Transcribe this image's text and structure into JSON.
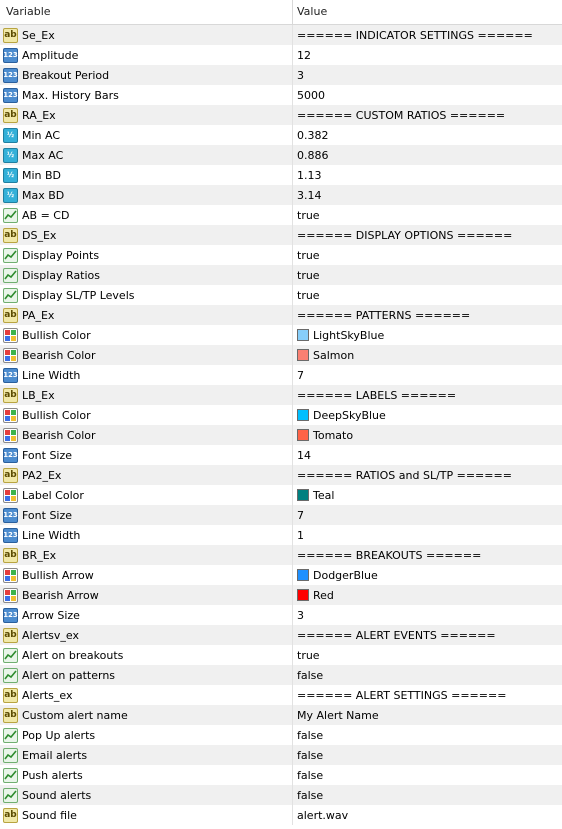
{
  "header": {
    "variable": "Variable",
    "value": "Value"
  },
  "rows": [
    {
      "icon": "ab",
      "name": "Se_Ex",
      "value": "====== INDICATOR SETTINGS ======"
    },
    {
      "icon": "123",
      "name": "Amplitude",
      "value": "12"
    },
    {
      "icon": "123",
      "name": "Breakout Period",
      "value": "3"
    },
    {
      "icon": "123",
      "name": "Max. History Bars",
      "value": "5000"
    },
    {
      "icon": "ab",
      "name": "RA_Ex",
      "value": "====== CUSTOM RATIOS ======"
    },
    {
      "icon": "half",
      "name": "Min AC",
      "value": "0.382"
    },
    {
      "icon": "half",
      "name": "Max AC",
      "value": "0.886"
    },
    {
      "icon": "half",
      "name": "Min BD",
      "value": "1.13"
    },
    {
      "icon": "half",
      "name": "Max BD",
      "value": "3.14"
    },
    {
      "icon": "bool",
      "name": "AB = CD",
      "value": "true"
    },
    {
      "icon": "ab",
      "name": "DS_Ex",
      "value": "====== DISPLAY OPTIONS ======"
    },
    {
      "icon": "bool",
      "name": "Display Points",
      "value": "true"
    },
    {
      "icon": "bool",
      "name": "Display Ratios",
      "value": "true"
    },
    {
      "icon": "bool",
      "name": "Display SL/TP Levels",
      "value": "true"
    },
    {
      "icon": "ab",
      "name": "PA_Ex",
      "value": "====== PATTERNS  ======"
    },
    {
      "icon": "color",
      "name": "Bullish Color",
      "value": "LightSkyBlue",
      "swatch": "#87cefa"
    },
    {
      "icon": "color",
      "name": "Bearish Color",
      "value": "Salmon",
      "swatch": "#fa8072"
    },
    {
      "icon": "123",
      "name": "Line Width",
      "value": "7"
    },
    {
      "icon": "ab",
      "name": "LB_Ex",
      "value": "====== LABELS ======"
    },
    {
      "icon": "color",
      "name": "Bullish Color",
      "value": "DeepSkyBlue",
      "swatch": "#00bfff"
    },
    {
      "icon": "color",
      "name": "Bearish Color",
      "value": "Tomato",
      "swatch": "#ff6347"
    },
    {
      "icon": "123",
      "name": "Font Size",
      "value": "14"
    },
    {
      "icon": "ab",
      "name": "PA2_Ex",
      "value": "====== RATIOS and SL/TP ======"
    },
    {
      "icon": "color",
      "name": "Label Color",
      "value": "Teal",
      "swatch": "#008080"
    },
    {
      "icon": "123",
      "name": "Font Size",
      "value": "7"
    },
    {
      "icon": "123",
      "name": "Line Width",
      "value": "1"
    },
    {
      "icon": "ab",
      "name": "BR_Ex",
      "value": "====== BREAKOUTS ======"
    },
    {
      "icon": "color",
      "name": "Bullish Arrow",
      "value": "DodgerBlue",
      "swatch": "#1e90ff"
    },
    {
      "icon": "color",
      "name": "Bearish Arrow",
      "value": "Red",
      "swatch": "#ff0000"
    },
    {
      "icon": "123",
      "name": "Arrow Size",
      "value": "3"
    },
    {
      "icon": "ab",
      "name": "Alertsv_ex",
      "value": "====== ALERT EVENTS ======"
    },
    {
      "icon": "bool",
      "name": "Alert on breakouts",
      "value": "true"
    },
    {
      "icon": "bool",
      "name": "Alert on patterns",
      "value": "false"
    },
    {
      "icon": "ab",
      "name": "Alerts_ex",
      "value": "====== ALERT SETTINGS ======"
    },
    {
      "icon": "ab",
      "name": "Custom alert name",
      "value": "My Alert Name"
    },
    {
      "icon": "bool",
      "name": "Pop Up alerts",
      "value": "false"
    },
    {
      "icon": "bool",
      "name": "Email alerts",
      "value": "false"
    },
    {
      "icon": "bool",
      "name": "Push alerts",
      "value": "false"
    },
    {
      "icon": "bool",
      "name": "Sound alerts",
      "value": "false"
    },
    {
      "icon": "ab",
      "name": "Sound file",
      "value": "alert.wav"
    }
  ]
}
